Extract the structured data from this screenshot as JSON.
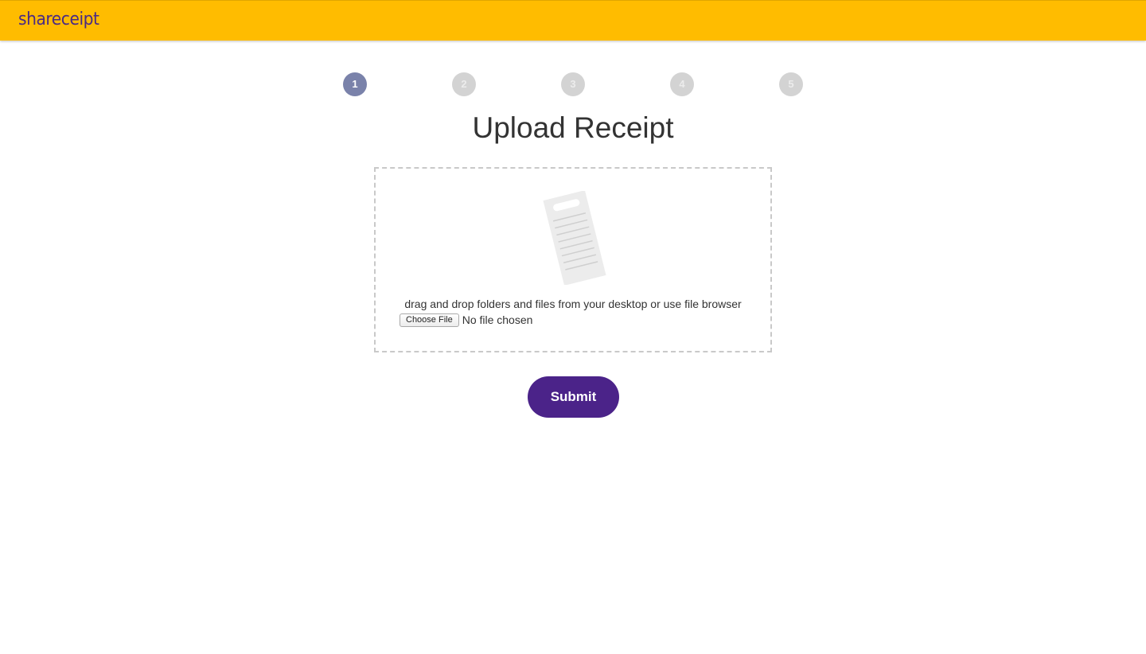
{
  "app": {
    "brand": "shareceipt",
    "brand_color": "#4a2a85",
    "header_color": "#FFBC00"
  },
  "stepper": {
    "current_step": 1,
    "steps": [
      "1",
      "2",
      "3",
      "4",
      "5"
    ],
    "active_color": "#7a82aa",
    "inactive_color": "#d3d3d3"
  },
  "main": {
    "title": "Upload Receipt",
    "dropzone": {
      "icon": "receipt-icon",
      "instructions": "drag and drop folders and files from your desktop or use file browser",
      "choose_file_label": "Choose File",
      "file_status": "No file chosen"
    },
    "submit_label": "Submit",
    "submit_color": "#4b2389"
  }
}
